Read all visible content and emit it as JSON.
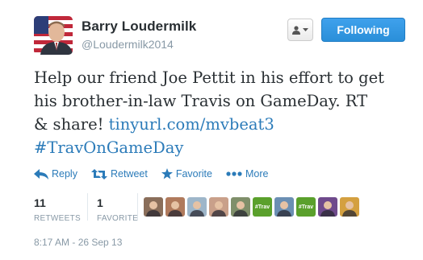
{
  "user": {
    "name": "Barry Loudermilk",
    "screen_name": "@Loudermilk2014"
  },
  "header": {
    "follow_label": "Following"
  },
  "tweet": {
    "line1": "Help our friend Joe Pettit in his effort to get",
    "line2": "his brother-in-law Travis on GameDay. RT",
    "line3_text": "& share! ",
    "link": "tinyurl.com/mvbeat3",
    "hashtag": "#TravOnGameDay"
  },
  "actions": {
    "reply": "Reply",
    "retweet": "Retweet",
    "favorite": "Favorite",
    "more": "More"
  },
  "stats": {
    "retweets_count": "11",
    "retweets_label": "RETWEETS",
    "favorites_count": "1",
    "favorites_label": "FAVORITE"
  },
  "favoriters": [
    {
      "color": "#8a6e5a"
    },
    {
      "color": "#b07a5c"
    },
    {
      "color": "#9eb6c9"
    },
    {
      "color": "#c9a08a"
    },
    {
      "color": "#7f8f6a"
    },
    {
      "color": "#5aa02c",
      "label": "#Trav"
    },
    {
      "color": "#6b8fb3"
    },
    {
      "color": "#5aa02c",
      "label": "#Trav"
    },
    {
      "color": "#6f4a8c"
    },
    {
      "color": "#d4a040"
    }
  ],
  "timestamp": "8:17 AM - 26 Sep 13",
  "colors": {
    "link": "#2b7bb9",
    "follow": "#2a8fd9",
    "muted": "#8899a6"
  }
}
